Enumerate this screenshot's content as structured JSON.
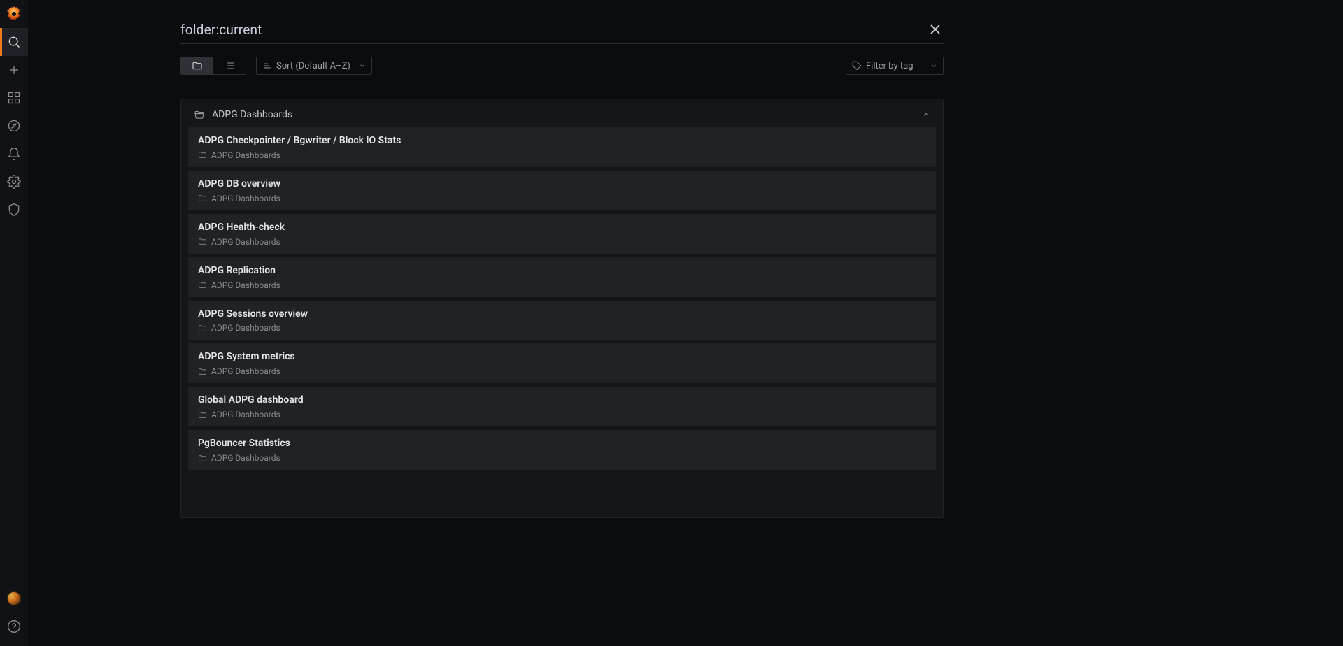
{
  "search": {
    "query": "folder:current",
    "sort_label": "Sort (Default A–Z)",
    "filter_tag_label": "Filter by tag"
  },
  "folder": {
    "name": "ADPG Dashboards"
  },
  "dashboards": [
    {
      "title": "ADPG Checkpointer / Bgwriter / Block IO Stats",
      "folder": "ADPG Dashboards"
    },
    {
      "title": "ADPG DB overview",
      "folder": "ADPG Dashboards"
    },
    {
      "title": "ADPG Health-check",
      "folder": "ADPG Dashboards"
    },
    {
      "title": "ADPG Replication",
      "folder": "ADPG Dashboards"
    },
    {
      "title": "ADPG Sessions overview",
      "folder": "ADPG Dashboards"
    },
    {
      "title": "ADPG System metrics",
      "folder": "ADPG Dashboards"
    },
    {
      "title": "Global ADPG dashboard",
      "folder": "ADPG Dashboards"
    },
    {
      "title": "PgBouncer Statistics",
      "folder": "ADPG Dashboards"
    }
  ]
}
